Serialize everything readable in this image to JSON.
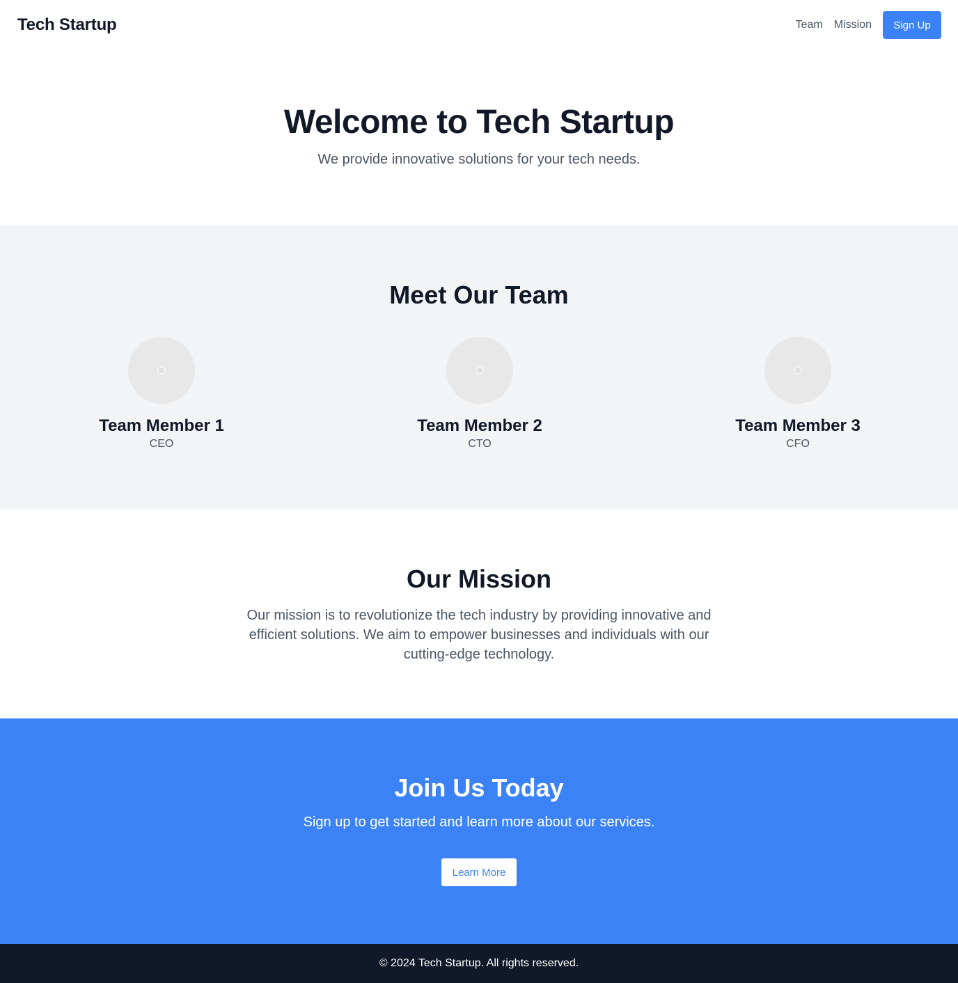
{
  "header": {
    "brand": "Tech Startup",
    "nav": [
      {
        "label": "Team"
      },
      {
        "label": "Mission"
      }
    ],
    "signup_label": "Sign Up"
  },
  "hero": {
    "title": "Welcome to Tech Startup",
    "subtitle": "We provide innovative solutions for your tech needs."
  },
  "team": {
    "title": "Meet Our Team",
    "members": [
      {
        "name": "Team Member 1",
        "role": "CEO",
        "avatar_icon": "image-placeholder-icon"
      },
      {
        "name": "Team Member 2",
        "role": "CTO",
        "avatar_icon": "image-placeholder-icon"
      },
      {
        "name": "Team Member 3",
        "role": "CFO",
        "avatar_icon": "image-placeholder-icon"
      }
    ]
  },
  "mission": {
    "title": "Our Mission",
    "body": "Our mission is to revolutionize the tech industry by providing innovative and efficient solutions. We aim to empower businesses and individuals with our cutting-edge technology."
  },
  "cta": {
    "title": "Join Us Today",
    "subtitle": "Sign up to get started and learn more about our services.",
    "button_label": "Learn More"
  },
  "footer": {
    "text": "© 2024 Tech Startup. All rights reserved."
  },
  "colors": {
    "primary": "#3b82f6",
    "dark": "#111827",
    "muted_text": "#4b5563",
    "section_gray": "#f3f4f6"
  }
}
